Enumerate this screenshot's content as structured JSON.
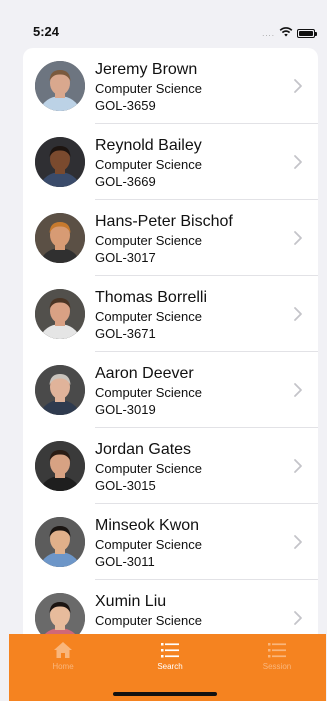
{
  "status_bar": {
    "time": "5:24",
    "signal_dots": "....",
    "icons": [
      "wifi-icon",
      "battery-icon"
    ]
  },
  "faculty": [
    {
      "name": "Jeremy Brown",
      "department": "Computer Science",
      "office": "GOL-3659",
      "avatar_colors": {
        "bg": "#6d7580",
        "skin": "#d9a88e",
        "hair": "#7a5a3e",
        "shirt": "#bcd2e6"
      }
    },
    {
      "name": "Reynold Bailey",
      "department": "Computer Science",
      "office": "GOL-3669",
      "avatar_colors": {
        "bg": "#2f2f33",
        "skin": "#7a4a2e",
        "hair": "#1d1410",
        "shirt": "#3a4b6a"
      }
    },
    {
      "name": "Hans-Peter Bischof",
      "department": "Computer Science",
      "office": "GOL-3017",
      "avatar_colors": {
        "bg": "#5b5045",
        "skin": "#d79b74",
        "hair": "#c77a2e",
        "shirt": "#303030"
      }
    },
    {
      "name": "Thomas Borrelli",
      "department": "Computer Science",
      "office": "GOL-3671",
      "avatar_colors": {
        "bg": "#52504c",
        "skin": "#d9a184",
        "hair": "#4a3424",
        "shirt": "#e5e5e5"
      }
    },
    {
      "name": "Aaron Deever",
      "department": "Computer Science",
      "office": "GOL-3019",
      "avatar_colors": {
        "bg": "#4a4a4a",
        "skin": "#e0b39a",
        "hair": "#c9c3bc",
        "shirt": "#2f3b4f"
      }
    },
    {
      "name": "Jordan Gates",
      "department": "Computer Science",
      "office": "GOL-3015",
      "avatar_colors": {
        "bg": "#3a3a3a",
        "skin": "#d7a283",
        "hair": "#2a1c14",
        "shirt": "#1e1e1e"
      }
    },
    {
      "name": "Minseok Kwon",
      "department": "Computer Science",
      "office": "GOL-3011",
      "avatar_colors": {
        "bg": "#5c5c5c",
        "skin": "#e0b08a",
        "hair": "#1a1512",
        "shirt": "#6d96c8"
      }
    },
    {
      "name": "Xumin Liu",
      "department": "Computer Science",
      "office": "",
      "avatar_colors": {
        "bg": "#6a6a6a",
        "skin": "#e7bb9c",
        "hair": "#1c1512",
        "shirt": "#d06878"
      }
    }
  ],
  "tab_bar": {
    "background": "#f58320",
    "tabs": [
      {
        "label": "Home",
        "icon": "home-icon",
        "active": false
      },
      {
        "label": "Search",
        "icon": "list-icon",
        "active": true
      },
      {
        "label": "Session",
        "icon": "list-icon",
        "active": false
      }
    ]
  }
}
